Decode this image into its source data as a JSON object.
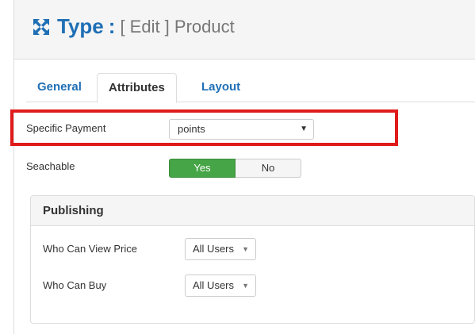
{
  "header": {
    "icon": "expand-arrows-icon",
    "title_strong": "Type",
    "title_sep": ":",
    "title_rest": "[ Edit ] Product"
  },
  "tabs": [
    {
      "label": "General",
      "active": false
    },
    {
      "label": "Attributes",
      "active": true
    },
    {
      "label": "Layout",
      "active": false
    }
  ],
  "fields": {
    "specific_payment": {
      "label": "Specific Payment",
      "value": "points"
    },
    "searchable": {
      "label": "Seachable",
      "yes_label": "Yes",
      "no_label": "No",
      "selected": "Yes"
    }
  },
  "publishing": {
    "title": "Publishing",
    "who_can_view_price": {
      "label": "Who Can View Price",
      "value": "All Users"
    },
    "who_can_buy": {
      "label": "Who Can Buy",
      "value": "All Users"
    }
  },
  "colors": {
    "accent": "#1f6fb5",
    "highlight": "#e01b1b",
    "toggle_yes": "#46a546"
  }
}
